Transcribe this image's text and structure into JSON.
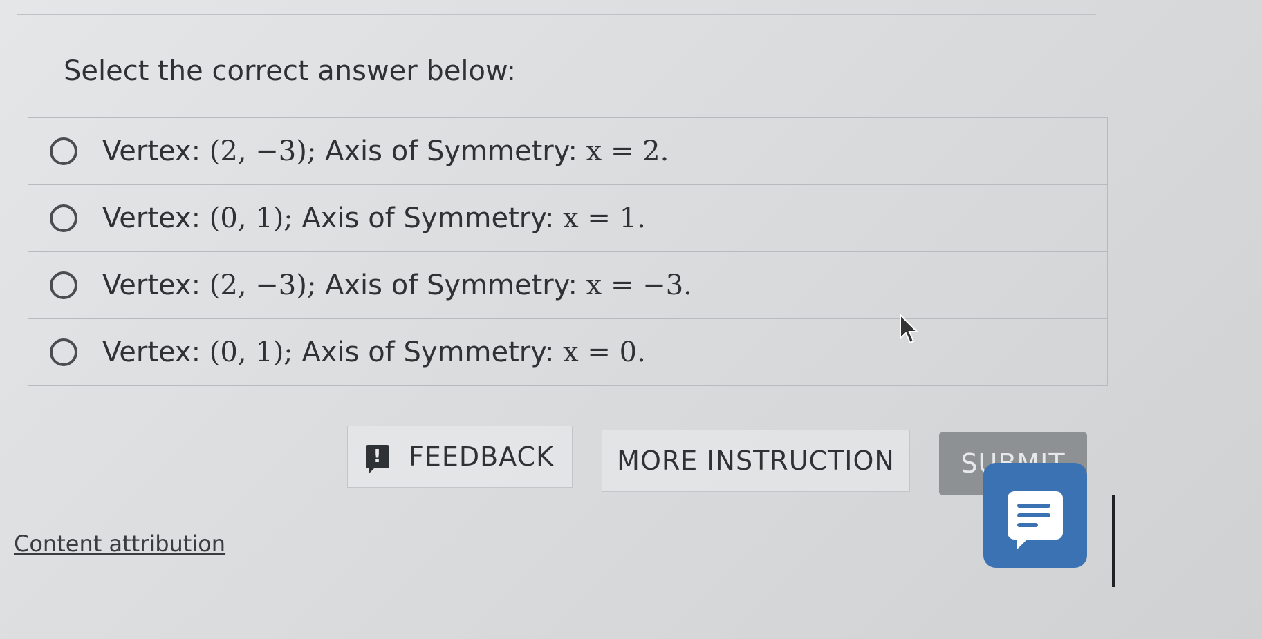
{
  "prompt": "Select the correct answer below:",
  "options": [
    {
      "label_text": "Vertex: ",
      "math": "(2, −3); ",
      "label_mid": "Axis of Symmetry: ",
      "eq": "x = 2."
    },
    {
      "label_text": "Vertex: ",
      "math": "(0, 1); ",
      "label_mid": "Axis of Symmetry: ",
      "eq": "x = 1."
    },
    {
      "label_text": "Vertex: ",
      "math": "(2, −3); ",
      "label_mid": "Axis of Symmetry: ",
      "eq": "x = −3."
    },
    {
      "label_text": "Vertex: ",
      "math": "(0, 1); ",
      "label_mid": "Axis of Symmetry: ",
      "eq": "x = 0."
    }
  ],
  "buttons": {
    "feedback": "FEEDBACK",
    "feedback_icon": "!",
    "more_instruction": "MORE INSTRUCTION",
    "submit": "SUBMIT"
  },
  "attribution": "Content attribution",
  "icons": {
    "radio": "radio-icon",
    "feedback": "feedback-icon",
    "chat": "chat-icon",
    "cursor": "cursor-icon"
  },
  "colors": {
    "chat_widget": "#3a72b4",
    "submit_bg": "#8d9193",
    "text": "#2f3234"
  }
}
